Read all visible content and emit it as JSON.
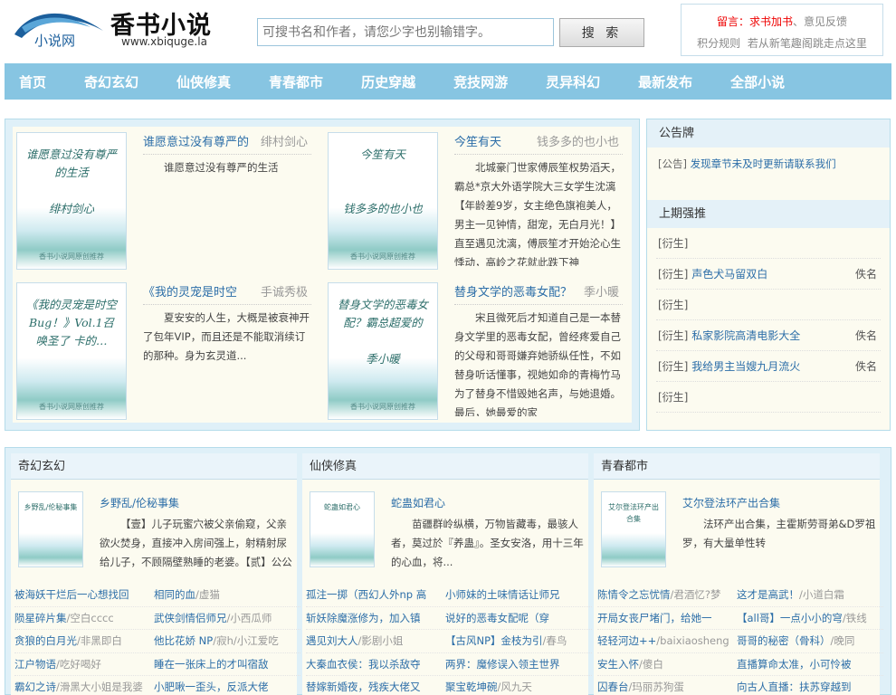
{
  "header": {
    "logo_text": "小说网",
    "site_title": "香书小说",
    "site_url": "www.xbiquge.la",
    "search_placeholder": "可搜书名和作者，请您少字也别输错字。",
    "search_button": "搜 索",
    "top_links": {
      "notice_prefix": "留言：",
      "add_book": "求书加书",
      "separator": "、",
      "feedback": "意见反馈",
      "points_rule": "积分规则",
      "new_site_tip": "若从新笔趣阁跳走点这里"
    }
  },
  "nav": [
    "首页",
    "奇幻玄幻",
    "仙侠修真",
    "青春都市",
    "历史穿越",
    "竞技网游",
    "灵异科幻",
    "最新发布",
    "全部小说"
  ],
  "featured": [
    {
      "title": "谁愿意过没有尊严的",
      "author": "绯村剑心",
      "cover_title": "谁愿意过没有尊严的生活",
      "cover_author": "绯村剑心",
      "cover_footer": "香书小说网原创推荐",
      "desc": "谁愿意过没有尊严的生活"
    },
    {
      "title": "今笙有天",
      "author": "钱多多的也小也",
      "cover_title": "今笙有天",
      "cover_author": "钱多多的也小也",
      "cover_footer": "香书小说网原创推荐",
      "desc": "北城豪门世家傅辰笙权势滔天，霸总*京大外语学院大三女学生沈漓【年龄差9岁，女主绝色旗袍美人，男主一见钟情，甜宠，无白月光！】直至遇见沈漓，傅辰笙才开始沦心生悸动，高岭之花就此跌下神"
    },
    {
      "title": "《我的灵宠是时空",
      "author": "手诚秀极",
      "cover_title": "《我的灵宠是时空Bug！》Vol.1召唤圣了 卡的…",
      "cover_author": "手诚秀极",
      "cover_footer": "香书小说网原创推荐",
      "desc": "夏安安的人生，大概是被衰神开了包年VIP，而且还是不能取消续订的那种。身为玄灵道..."
    },
    {
      "title": "替身文学的恶毒女配？",
      "author": "季小暖",
      "cover_title": "替身文学的恶毒女配？霸总超爱的",
      "cover_author": "季小暖",
      "cover_footer": "香书小说网原创推荐",
      "desc": "宋且微死后才知道自己是一本替身文学里的恶毒女配，曾经疼爱自己的父母和哥哥嫌弃她骄纵任性，不如替身听话懂事，视她如命的青梅竹马为了替身不惜毁她名声，与她退婚。最后，她最爱的家"
    }
  ],
  "notice_board": {
    "title": "公告牌",
    "tag": "[公告]",
    "text": "发现章节未及时更新请联系我们"
  },
  "last_rank": {
    "title": "上期强推",
    "items": [
      {
        "tag": "[衍生]",
        "name": "",
        "author": ""
      },
      {
        "tag": "[衍生]",
        "name": "声色犬马留双白",
        "author": "佚名"
      },
      {
        "tag": "[衍生]",
        "name": "",
        "author": ""
      },
      {
        "tag": "[衍生]",
        "name": "私家影院高清电影大全",
        "author": "佚名"
      },
      {
        "tag": "[衍生]",
        "name": "我给男主当嫂九月流火",
        "author": "佚名"
      },
      {
        "tag": "[衍生]",
        "name": "",
        "author": ""
      }
    ]
  },
  "categories": [
    {
      "name": "奇幻玄幻",
      "book_title": "乡野乱/伦秘事集",
      "cover_title": "乡野乱/伦秘事集",
      "desc": "【壹】儿子玩蜜穴被父亲偷窥，父亲欲火焚身，直接冲入房间强上，射精射尿给儿子，不顾隔壁熟睡的老婆。【贰】公公和",
      "list": [
        [
          "被海妖干烂后一心想找回",
          ""
        ],
        [
          "相同的血",
          "虚猫"
        ],
        [
          "陨星碎片集",
          "空白cccc"
        ],
        [
          "武侠剑情侣师兄",
          "小西瓜师"
        ],
        [
          "贪狼的白月光",
          "非黑即白"
        ],
        [
          "他比花娇 NP",
          "寂h",
          "小江爱吃"
        ],
        [
          "江户物语",
          "吃好喝好"
        ],
        [
          "睡在一张床上的才叫宿敌",
          ""
        ],
        [
          "霸幻之诗",
          "滑黑大小姐是我婆"
        ],
        [
          "小肥啾一歪头，反派大佬",
          ""
        ]
      ]
    },
    {
      "name": "仙侠修真",
      "book_title": "蛇蛊如君心",
      "cover_title": "蛇蛊如君心",
      "desc": "苗疆群岭纵横，万物皆藏毒，最骇人者，莫过於『养蛊』。圣女安洛，用十三年的心血，将...",
      "list": [
        [
          "孤注一掷（西幻人外np 高",
          ""
        ],
        [
          "小师妹的土味情话让师兄",
          ""
        ],
        [
          "斩妖除魔涨修为，加入镇",
          ""
        ],
        [
          "说好的恶毒女配呢（穿",
          ""
        ],
        [
          "遇见刘大人",
          "影剧小姐"
        ],
        [
          "【古风NP】金枝为引",
          "春鸟"
        ],
        [
          "大秦血衣侯：我以杀敌夺",
          ""
        ],
        [
          "两界：魔修误入领主世界",
          ""
        ],
        [
          "替嫁新婚夜，残疾大佬又",
          ""
        ],
        [
          "聚宝乾坤碗",
          "风九天"
        ]
      ]
    },
    {
      "name": "青春都市",
      "book_title": "艾尔登法环产出合集",
      "cover_title": "艾尔登法环产出合集",
      "desc": "法环产出合集，主霍斯劳哥弟&D罗祖罗，有大量单性转",
      "list": [
        [
          "陈情令之忘忧情",
          "君酒忆?梦"
        ],
        [
          "这才是高武！",
          "小道白霜"
        ],
        [
          "开局女丧尸堵门，给她一",
          ""
        ],
        [
          "【all哥】一点小小的穹",
          "铁线"
        ],
        [
          "轻轻河边++",
          "baixiaosheng"
        ],
        [
          "哥哥的秘密（骨科）",
          "晚同"
        ],
        [
          "安生入怀",
          "傻白"
        ],
        [
          "直播算命太准，小可怜被",
          ""
        ],
        [
          "囚春台",
          "玛丽苏狗蛋"
        ],
        [
          "向古人直播：扶苏穿越到",
          ""
        ]
      ]
    }
  ]
}
